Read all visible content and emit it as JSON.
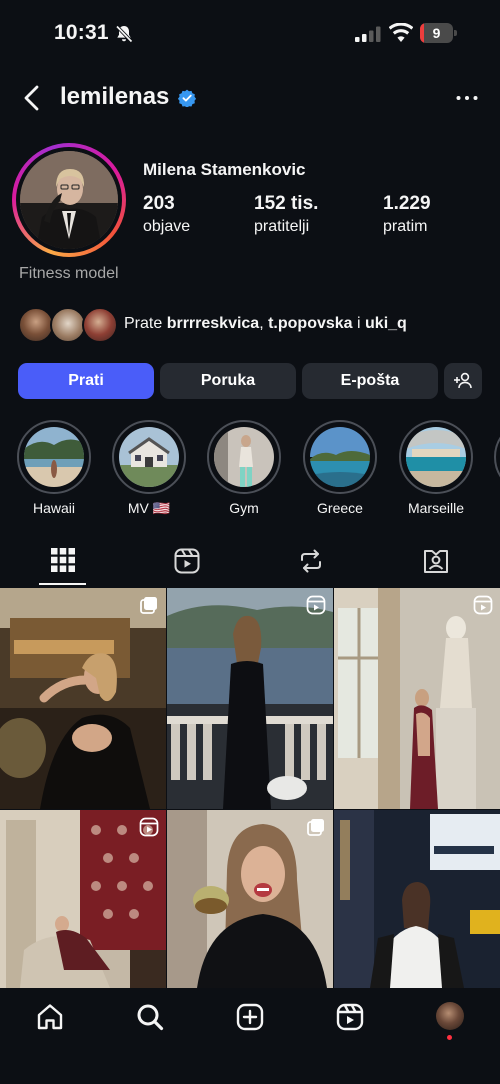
{
  "status_bar": {
    "time": "10:31",
    "battery_level": "9",
    "battery_fraction": 0.09
  },
  "header": {
    "username": "lemilenas"
  },
  "profile": {
    "full_name": "Milena Stamenkovic",
    "stats": [
      {
        "value": "203",
        "label": "objave"
      },
      {
        "value": "152 tis.",
        "label": "pratitelji"
      },
      {
        "value": "1.229",
        "label": "pratim"
      }
    ],
    "bio": "Fitness model",
    "followed_by": {
      "prefix": "Prate ",
      "user1": "brrrreskvica",
      "sep1": ", ",
      "user2": "t.popovska",
      "sep2": " i ",
      "user3": "uki_q"
    }
  },
  "actions": {
    "follow": "Prati",
    "message": "Poruka",
    "email": "E-pošta"
  },
  "highlights": [
    {
      "label": "Hawaii"
    },
    {
      "label": "MV 🇺🇸"
    },
    {
      "label": "Gym"
    },
    {
      "label": "Greece"
    },
    {
      "label": "Marseille"
    }
  ],
  "colors": {
    "background": "#0c0f14",
    "primary_button": "#4a5df9",
    "secondary_button": "#262a31",
    "verified": "#3797f0",
    "notification": "#ff3040"
  },
  "icons": {
    "status": [
      "bell-slash-icon",
      "signal-icon",
      "wifi-icon",
      "battery-icon"
    ],
    "header": [
      "back-icon",
      "verified-badge-icon",
      "more-icon"
    ],
    "tabs": [
      "grid-icon",
      "reels-icon",
      "reposts-icon",
      "tagged-icon"
    ],
    "bottom_nav": [
      "home-icon",
      "search-icon",
      "create-icon",
      "reels-icon",
      "profile-avatar"
    ]
  }
}
